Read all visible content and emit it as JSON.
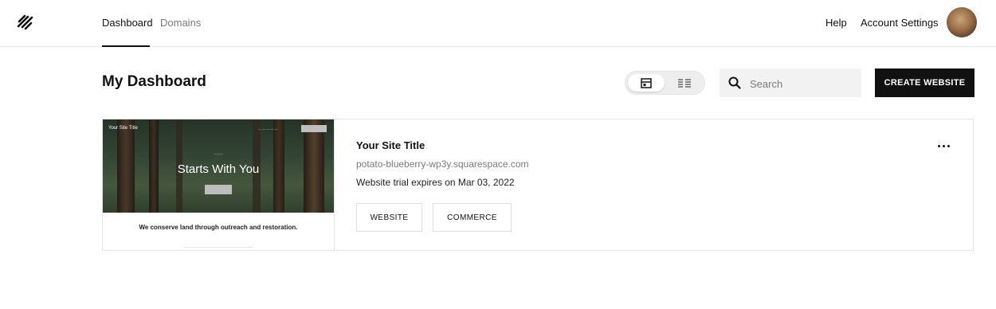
{
  "header": {
    "logo_icon": "squarespace-logo-icon",
    "tabs": [
      {
        "label": "Dashboard",
        "active": true
      },
      {
        "label": "Domains",
        "active": false
      }
    ],
    "help_label": "Help",
    "account_label": "Account Settings",
    "avatar_icon": "user-avatar"
  },
  "main": {
    "title": "My Dashboard",
    "view_toggle": {
      "options": [
        {
          "icon": "grid-view-icon",
          "active": true
        },
        {
          "icon": "list-view-icon",
          "active": false
        }
      ]
    },
    "search": {
      "placeholder": "Search",
      "value": "",
      "icon": "search-icon"
    },
    "create_button_label": "CREATE WEBSITE",
    "site_card": {
      "title": "Your Site Title",
      "domain": "potato-blueberry-wp3y.squarespace.com",
      "trial_text": "Website trial expires on Mar 03, 2022",
      "buttons": [
        {
          "label": "WEBSITE"
        },
        {
          "label": "COMMERCE"
        }
      ],
      "more_icon": "more-horizontal-icon",
      "thumbnail": {
        "site_title": "Your Site Title",
        "headline": "Starts With You",
        "heading": "We conserve land through outreach and restoration."
      }
    }
  },
  "colors": {
    "primary_button": "#111111",
    "background": "#ffffff",
    "search_bg": "#f2f2f2",
    "muted_text": "#7a7a7a",
    "border": "#e4e4e4"
  }
}
